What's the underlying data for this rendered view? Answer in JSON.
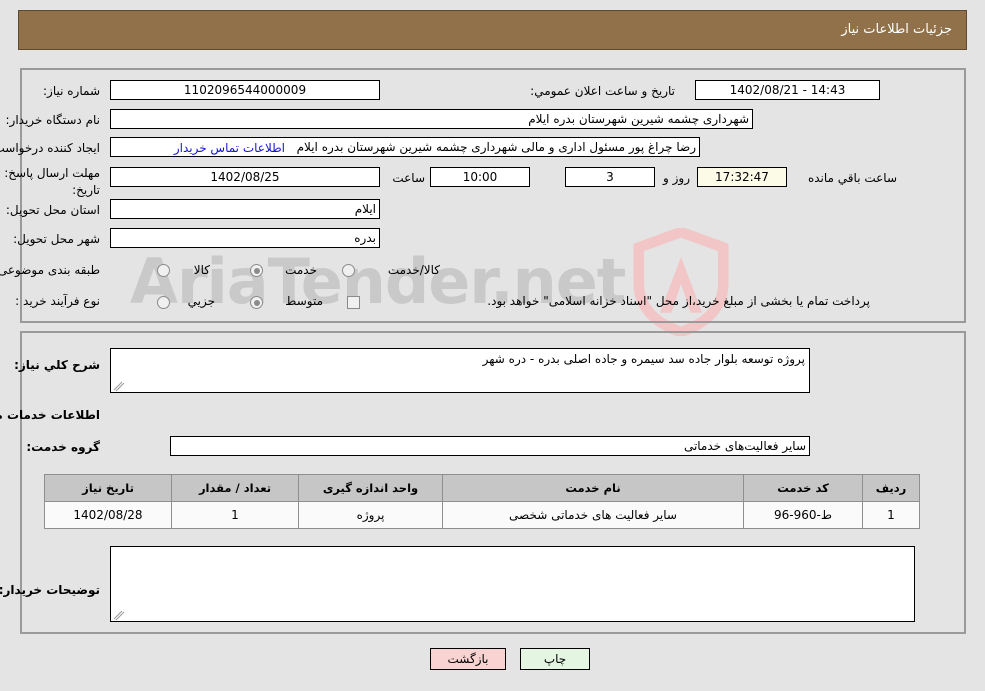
{
  "header": {
    "title": "جزئیات اطلاعات نیاز"
  },
  "form": {
    "need_number_label": "شماره نیاز:",
    "need_number_value": "1102096544000009",
    "public_announce_label": "تاریخ و ساعت اعلان عمومي:",
    "public_announce_value": "14:43 - 1402/08/21",
    "buyer_org_label": "نام دستگاه خریدار:",
    "buyer_org_value": "شهرداری چشمه شیرین شهرستان بدره ایلام",
    "requester_label": "ایجاد کننده درخواست:",
    "requester_value": "رضا چراغ پور مسئول اداری و مالی شهرداری چشمه شیرین شهرستان بدره ایلام",
    "contact_link": "اطلاعات تماس خریدار",
    "deadline_label_line1": "مهلت ارسال پاسخ: تا",
    "deadline_label_line2": "تاریخ:",
    "deadline_date": "1402/08/25",
    "hour_label": "ساعت",
    "hour_value": "10:00",
    "days_value": "3",
    "days_label": "روز و",
    "countdown_value": "17:32:47",
    "remaining_label": "ساعت باقي مانده",
    "province_label": "استان محل تحویل:",
    "province_value": "ایلام",
    "city_label": "شهر محل تحویل:",
    "city_value": "بدره",
    "category_label": "طبقه بندی موضوعی:",
    "category_options": [
      {
        "label": "کالا",
        "selected": false
      },
      {
        "label": "خدمت",
        "selected": true
      },
      {
        "label": "کالا/خدمت",
        "selected": false
      }
    ],
    "process_label": "نوع فرآیند خرید :",
    "process_options": [
      {
        "label": "جزیي",
        "selected": false
      },
      {
        "label": "متوسط",
        "selected": true
      }
    ],
    "treasury_checkbox_checked": false,
    "treasury_text": "پرداخت تمام یا بخشی از مبلغ خرید،از محل \"اسناد خزانه اسلامی\" خواهد بود."
  },
  "details": {
    "general_desc_label": "شرح كلي نياز:",
    "general_desc_value": "پروژه توسعه بلوار جاده سد سیمره و جاده اصلی بدره - دره شهر",
    "services_section_title": "اطلاعات خدمات مورد نیاز",
    "service_group_label": "گروه خدمت:",
    "service_group_value": "سایر فعالیت‌های خدماتی",
    "buyer_notes_label": "توضیحات خریدار:",
    "buyer_notes_value": ""
  },
  "table": {
    "headers": [
      "ردیف",
      "کد خدمت",
      "نام خدمت",
      "واحد اندازه گیری",
      "تعداد / مقدار",
      "تاریخ نیاز"
    ],
    "rows": [
      {
        "row_no": "1",
        "service_code": "ط-960-96",
        "service_name": "سایر فعالیت های خدماتی شخصی",
        "unit": "پروژه",
        "quantity": "1",
        "need_date": "1402/08/28"
      }
    ]
  },
  "footer": {
    "print_label": "چاپ",
    "back_label": "بازگشت"
  },
  "watermark": {
    "text": "AriaTender.net"
  },
  "colors": {
    "header_bg": "#91714a",
    "page_bg": "#e4e4e4",
    "link": "#1414d2",
    "table_header_bg": "#c6c6c6",
    "print_btn_bg": "#e4f5e2",
    "back_btn_bg": "#f9d2d2",
    "countdown_bg": "#fbfbe8"
  }
}
